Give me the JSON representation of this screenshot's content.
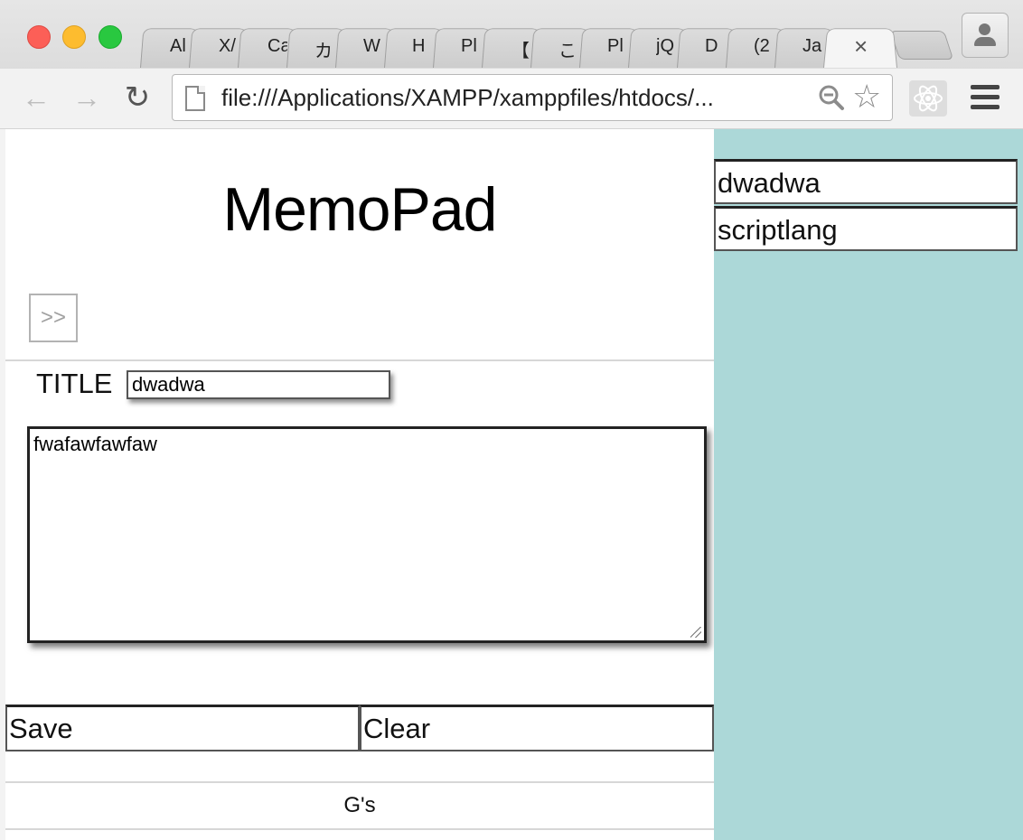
{
  "browser": {
    "tabs": [
      {
        "label": "Al"
      },
      {
        "label": "X/"
      },
      {
        "label": "Ca"
      },
      {
        "label": "カ"
      },
      {
        "label": "W"
      },
      {
        "label": "H"
      },
      {
        "label": "Pl"
      },
      {
        "label": "【"
      },
      {
        "label": "こ"
      },
      {
        "label": "Pl"
      },
      {
        "label": "jQ"
      },
      {
        "label": "D"
      },
      {
        "label": "(2"
      },
      {
        "label": "Ja"
      }
    ],
    "active_tab_close": "×",
    "url": "file:///Applications/XAMPP/xamppfiles/htdocs/..."
  },
  "page": {
    "heading": "MemoPad",
    "toggle_label": ">>",
    "title_label": "TITLE",
    "title_value": "dwadwa",
    "body_value": "fwafawfawfaw",
    "save_label": "Save",
    "clear_label": "Clear",
    "footer_text": "G's"
  },
  "sidebar": {
    "items": [
      {
        "title": "dwadwa"
      },
      {
        "title": "scriptlang"
      }
    ]
  },
  "colors": {
    "sidebar_bg": "#acd8d8",
    "close_red": "#fc5f57",
    "minimize_yellow": "#fdbc2f",
    "zoom_green": "#29c840"
  }
}
